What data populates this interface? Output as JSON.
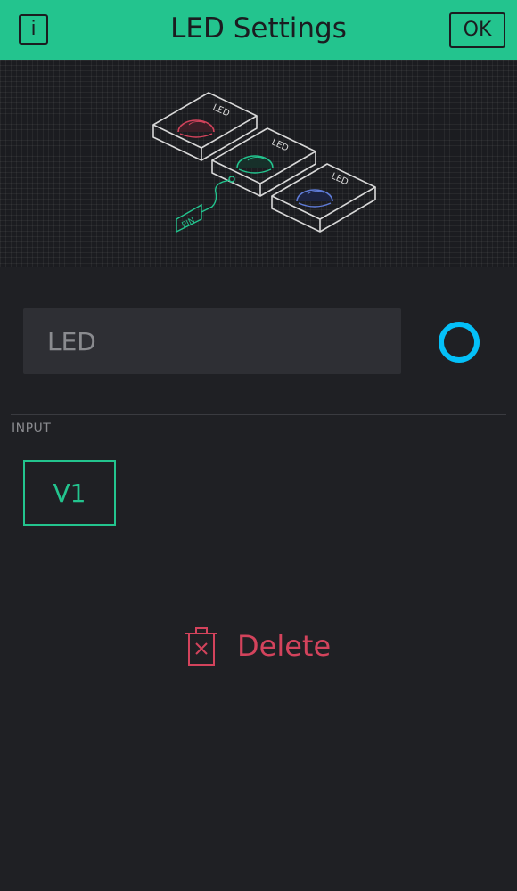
{
  "header": {
    "title": "LED Settings",
    "info_label": "i",
    "ok_label": "OK",
    "background_color": "#23c48e"
  },
  "preview": {
    "devices": [
      {
        "label": "LED",
        "color": "#d3435c"
      },
      {
        "label": "LED",
        "color": "#23c48e"
      },
      {
        "label": "LED",
        "color": "#5f7cd8"
      }
    ],
    "pin_label": "PIN"
  },
  "settings": {
    "name_field": {
      "value": "LED",
      "placeholder": "LED"
    },
    "color_picker": {
      "color": "#04c0f8"
    },
    "input_section_label": "INPUT",
    "input_pin": "V1"
  },
  "actions": {
    "delete_label": "Delete",
    "delete_color": "#d3435c",
    "delete_icon": "trash-icon"
  }
}
